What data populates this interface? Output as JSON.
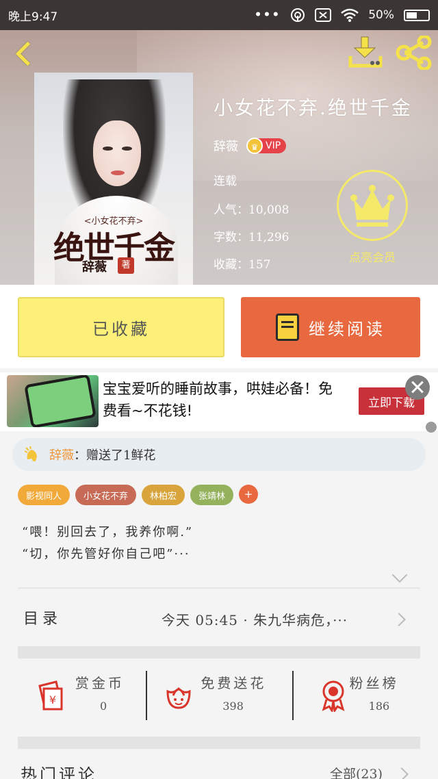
{
  "status_bar": {
    "time": "晚上9:47",
    "battery": "50%",
    "battery_level": 0.5
  },
  "header": {
    "back_icon": "chevron-left-icon",
    "download_icon": "download-icon",
    "share_icon": "share-icon"
  },
  "cover": {
    "subtitle": "<小女花不弃>",
    "title": "绝世千金",
    "author": "辞薇",
    "seal": "著"
  },
  "book": {
    "title": "小女花不弃.绝世千金",
    "author": "辞薇",
    "vip_label": "VIP",
    "status": "连载",
    "popularity": "人气：10,008",
    "word_count": "字数：11,296",
    "favorites": "收藏：157"
  },
  "member": {
    "label": "点亮会员",
    "icon": "crown-icon"
  },
  "actions": {
    "favorited_label": "已收藏",
    "continue_label": "继续阅读",
    "continue_icon": "book-icon"
  },
  "ad": {
    "text": "宝宝爱听的睡前故事，哄娃必备！免费看~不花钱!",
    "button": "立即下载"
  },
  "gift_bar": {
    "user": "辞薇",
    "text": "：赠送了1鲜花"
  },
  "tags": [
    {
      "label": "影视同人",
      "color": "#f1a93a"
    },
    {
      "label": "小女花不弃",
      "color": "#c76b57"
    },
    {
      "label": "林柏宏",
      "color": "#d9a43b"
    },
    {
      "label": "张靖林",
      "color": "#93b25b"
    }
  ],
  "tag_add": "+",
  "excerpt": {
    "line1": "“喂！别回去了，我养你啊.”",
    "line2": "“切，你先管好你自己吧”···"
  },
  "toc": {
    "label": "目录",
    "latest": "今天 05:45 · 朱九华病危，···"
  },
  "stats": [
    {
      "label": "赏金币",
      "value": "0",
      "icon": "red-envelope-icon"
    },
    {
      "label": "免费送花",
      "value": "398",
      "icon": "flower-icon"
    },
    {
      "label": "粉丝榜",
      "value": "186",
      "icon": "medal-icon"
    }
  ],
  "comments": {
    "title": "热门评论",
    "all_label": "全部(23)"
  },
  "colors": {
    "accent_orange": "#e8683f",
    "fav_yellow": "#fdf079",
    "member_yellow": "#f5e96a",
    "stat_red": "#d9352b"
  }
}
